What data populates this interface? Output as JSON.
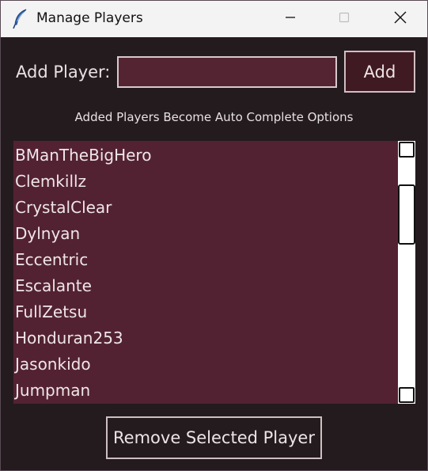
{
  "window": {
    "title": "Manage Players",
    "icons": {
      "app": "feather-icon",
      "minimize": "minimize-icon",
      "maximize": "maximize-icon",
      "close": "close-icon"
    }
  },
  "form": {
    "add_label": "Add Player:",
    "input_value": "",
    "add_button_label": "Add",
    "hint": "Added Players Become Auto Complete Options"
  },
  "players": [
    "BManTheBigHero",
    "Clemkillz",
    "CrystalClear",
    "Dylnyan",
    "Eccentric",
    "Escalante",
    "FullZetsu",
    "Honduran253",
    "Jasonkido",
    "Jumpman"
  ],
  "remove_button_label": "Remove Selected Player",
  "colors": {
    "background": "#241b1f",
    "list_background": "#532232",
    "input_background": "#542432",
    "add_button_background": "#3f1a22",
    "text": "#e8e2e4",
    "titlebar": "#f3f3f3"
  }
}
